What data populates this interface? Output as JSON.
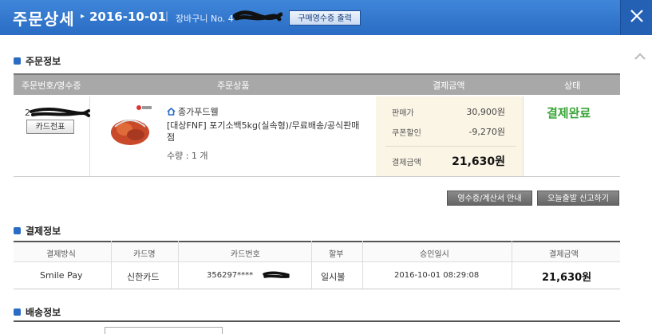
{
  "header": {
    "title": "주문상세",
    "date": "2016-10-01",
    "separator": "|",
    "cart_label": "장바구니 No. 4",
    "receipt_button": "구매영수증 출력",
    "close_icon": "close-icon"
  },
  "order_info": {
    "title": "주문정보",
    "columns": [
      "주문번호/영수증",
      "주문상품",
      "결제금액",
      "상태"
    ],
    "card_slip_button": "카드전표",
    "seller": "종가푸드웰",
    "product_name": "[대상FNF] 포기소백5kg(실속형)/무료배송/공식판매점",
    "quantity": "수량 : 1 개",
    "sale_price_label": "판매가",
    "sale_price": "30,900원",
    "coupon_label": "쿠폰할인",
    "coupon_value": "-9,270원",
    "total_label": "결제금액",
    "total_value": "21,630원",
    "status": "결제완료"
  },
  "actions": {
    "receipt_tax_button": "영수증/계산서 안내",
    "report_button": "오늘출발 신고하기"
  },
  "payment_info": {
    "title": "결제정보",
    "columns": [
      "결제방식",
      "카드명",
      "카드번호",
      "할부",
      "승인일시",
      "결제금액"
    ],
    "row": {
      "method": "Smile Pay",
      "card_name": "신한카드",
      "card_number": "356297****",
      "installment": "일시불",
      "approved_at": "2016-10-01 08:29:08",
      "amount": "21,630원"
    }
  },
  "delivery_info": {
    "title": "배송정보"
  },
  "colors": {
    "header_blue": "#2a6cc4",
    "status_green": "#3aa536",
    "table_header_gray": "#a8a8a8",
    "price_box": "#fbf5e6"
  }
}
